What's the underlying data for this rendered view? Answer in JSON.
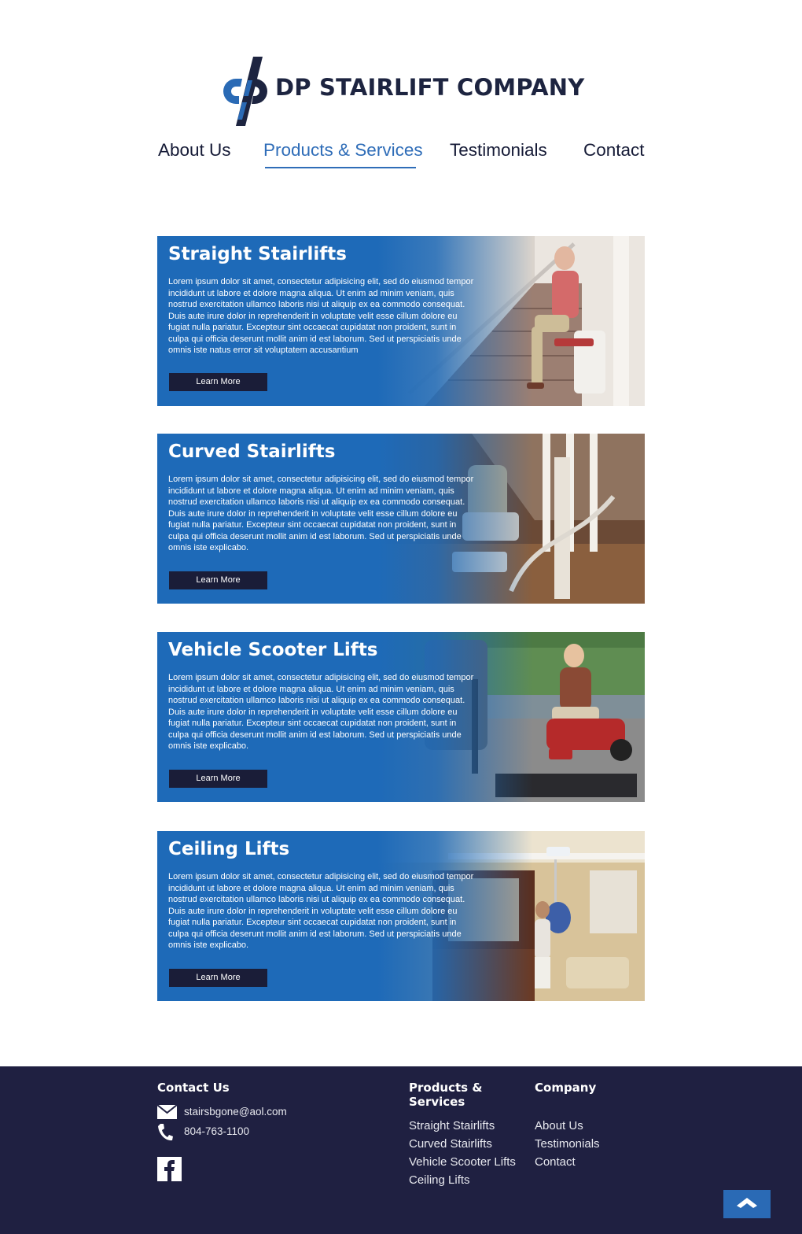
{
  "brand": {
    "name": "DP STAIRLIFT COMPANY",
    "primary_color": "#1e6ab8",
    "dark_color": "#1f2041"
  },
  "nav": {
    "items": [
      {
        "label": "About Us",
        "active": false
      },
      {
        "label": "Products & Services",
        "active": true
      },
      {
        "label": "Testimonials",
        "active": false
      },
      {
        "label": "Contact",
        "active": false
      }
    ]
  },
  "products": [
    {
      "title": "Straight Stairlifts",
      "body": "Lorem ipsum dolor sit amet, consectetur adipisicing elit, sed do eiusmod tempor incididunt ut labore et dolore magna aliqua. Ut enim ad minim veniam, quis nostrud exercitation ullamco laboris nisi ut aliquip ex ea commodo consequat. Duis aute irure dolor in reprehenderit in voluptate velit esse cillum dolore eu fugiat nulla pariatur. Excepteur sint occaecat cupidatat non proident, sunt in culpa qui officia deserunt mollit anim id est laborum. Sed ut perspiciatis unde omnis iste natus error sit voluptatem accusantium",
      "button": "Learn More",
      "photo": "stairlift-photo"
    },
    {
      "title": "Curved Stairlifts",
      "body": "Lorem ipsum dolor sit amet, consectetur adipisicing elit, sed do eiusmod tempor incididunt ut labore et dolore magna aliqua. Ut enim ad minim veniam, quis nostrud exercitation ullamco laboris nisi ut aliquip ex ea commodo consequat. Duis aute irure dolor in reprehenderit in voluptate velit esse cillum dolore eu fugiat nulla pariatur. Excepteur sint occaecat cupidatat non proident, sunt in culpa qui officia deserunt mollit anim id est laborum. Sed ut perspiciatis unde omnis iste explicabo.",
      "button": "Learn More",
      "photo": "curved-stairlift-photo"
    },
    {
      "title": "Vehicle Scooter Lifts",
      "body": "Lorem ipsum dolor sit amet, consectetur adipisicing elit, sed do eiusmod tempor incididunt ut labore et dolore magna aliqua. Ut enim ad minim veniam, quis nostrud exercitation ullamco laboris nisi ut aliquip ex ea commodo consequat. Duis aute irure dolor in reprehenderit in voluptate velit esse cillum dolore eu fugiat nulla pariatur. Excepteur sint occaecat cupidatat non proident, sunt in culpa qui officia deserunt mollit anim id est laborum. Sed ut perspiciatis unde omnis iste explicabo.",
      "button": "Learn More",
      "photo": "scooter-lift-photo"
    },
    {
      "title": "Ceiling Lifts",
      "body": "Lorem ipsum dolor sit amet, consectetur adipisicing elit, sed do eiusmod tempor incididunt ut labore et dolore magna aliqua. Ut enim ad minim veniam, quis nostrud exercitation ullamco laboris nisi ut aliquip ex ea commodo consequat. Duis aute irure dolor in reprehenderit in voluptate velit esse cillum dolore eu fugiat nulla pariatur. Excepteur sint occaecat cupidatat non proident, sunt in culpa qui officia deserunt mollit anim id est laborum. Sed ut perspiciatis unde omnis iste explicabo.",
      "button": "Learn More",
      "photo": "ceiling-lift-photo"
    }
  ],
  "footer": {
    "contact_heading": "Contact Us",
    "email": "stairsbgone@aol.com",
    "phone": "804-763-1100",
    "products_heading": "Products & Services",
    "products_links": [
      "Straight Stairlifts",
      "Curved Stairlifts",
      "Vehicle Scooter Lifts",
      "Ceiling Lifts"
    ],
    "company_heading": "Company",
    "company_links": [
      "About Us",
      "Testimonials",
      "Contact"
    ],
    "icons": [
      "mail-icon",
      "phone-icon",
      "facebook-icon",
      "chevron-up-icon"
    ]
  }
}
